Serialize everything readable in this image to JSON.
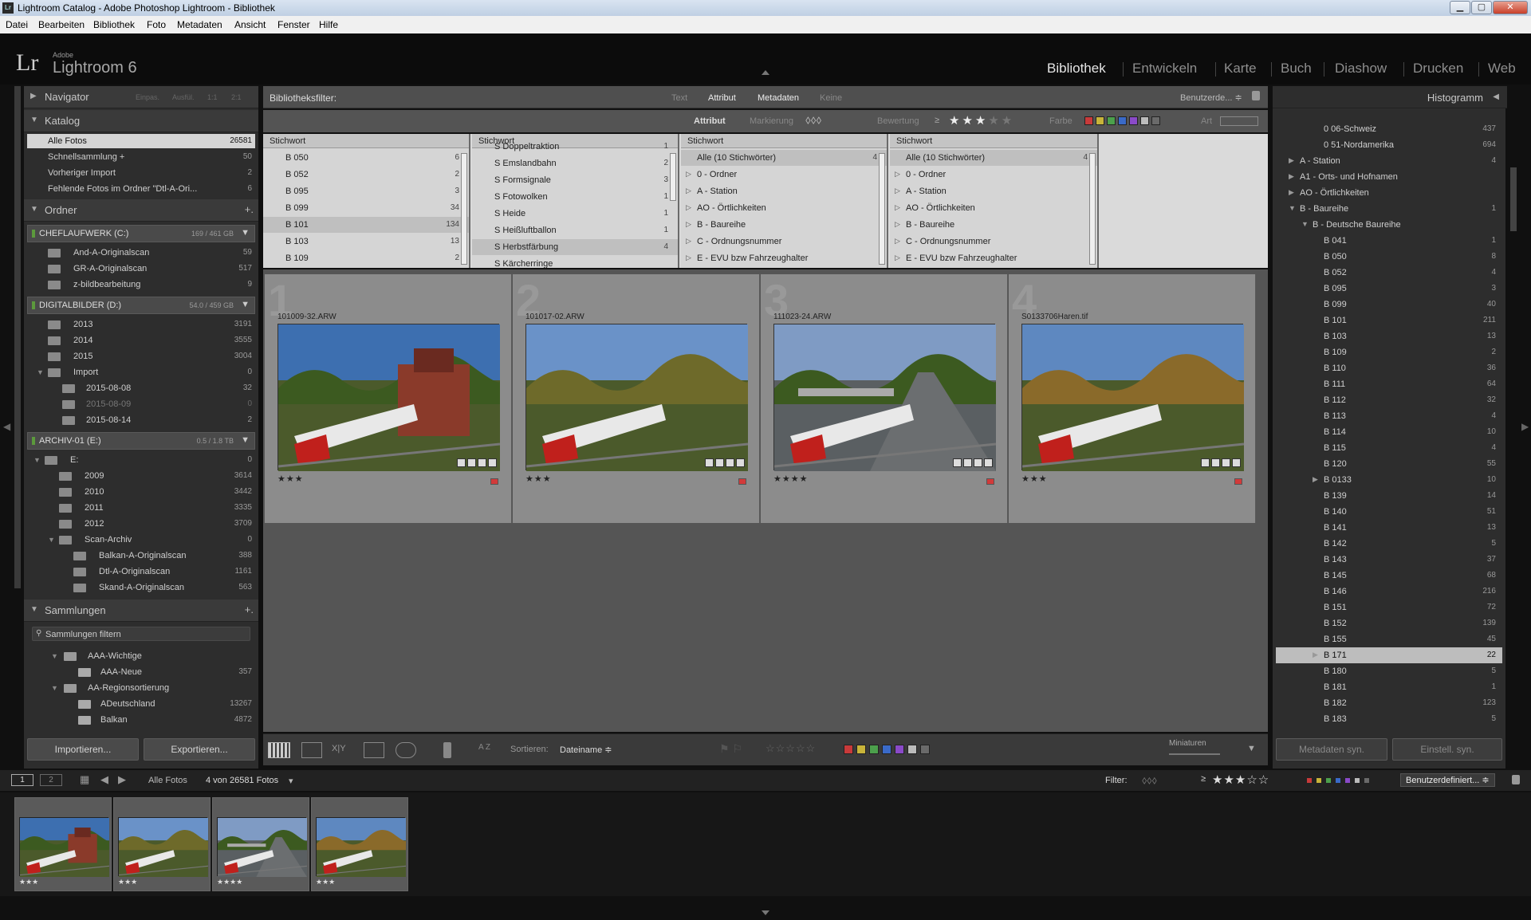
{
  "window": {
    "title": "Lightroom Catalog - Adobe Photoshop Lightroom - Bibliothek",
    "app_icon": "Lr"
  },
  "menu": [
    "Datei",
    "Bearbeiten",
    "Bibliothek",
    "Foto",
    "Metadaten",
    "Ansicht",
    "Fenster",
    "Hilfe"
  ],
  "logo": {
    "mark": "Lr",
    "adobe": "Adobe",
    "product": "Lightroom 6"
  },
  "modules": [
    "Bibliothek",
    "Entwickeln",
    "Karte",
    "Buch",
    "Diashow",
    "Drucken",
    "Web"
  ],
  "active_module": "Bibliothek",
  "left": {
    "navigator": {
      "label": "Navigator",
      "zoom": [
        "Einpas.",
        "Ausfül.",
        "1:1",
        "2:1"
      ]
    },
    "catalog": {
      "label": "Katalog",
      "items": [
        {
          "name": "Alle Fotos",
          "count": "26581"
        },
        {
          "name": "Schnellsammlung +",
          "count": "50"
        },
        {
          "name": "Vorheriger Import",
          "count": "2"
        },
        {
          "name": "Fehlende Fotos im Ordner \"Dtl-A-Ori...",
          "count": "6"
        }
      ]
    },
    "folders": {
      "label": "Ordner",
      "add": "+.",
      "vol1": {
        "name": "CHEFLAUFWERK (C:)",
        "size": "169 / 461 GB"
      },
      "vol1_items": [
        {
          "name": "And-A-Originalscan",
          "count": "59"
        },
        {
          "name": "GR-A-Originalscan",
          "count": "517"
        },
        {
          "name": "z-bildbearbeitung",
          "count": "9"
        }
      ],
      "vol2": {
        "name": "DIGITALBILDER (D:)",
        "size": "54.0 / 459 GB"
      },
      "vol2_items": [
        {
          "name": "2013",
          "count": "3191"
        },
        {
          "name": "2014",
          "count": "3555"
        },
        {
          "name": "2015",
          "count": "3004"
        },
        {
          "name": "Import",
          "count": "0"
        },
        {
          "name": "2015-08-08",
          "count": "32"
        },
        {
          "name": "2015-08-09",
          "count": "0"
        },
        {
          "name": "2015-08-14",
          "count": "2"
        }
      ],
      "vol3": {
        "name": "ARCHIV-01 (E:)",
        "size": "0.5 / 1.8 TB"
      },
      "vol3_items": [
        {
          "name": "E:",
          "count": "0"
        },
        {
          "name": "2009",
          "count": "3614"
        },
        {
          "name": "2010",
          "count": "3442"
        },
        {
          "name": "2011",
          "count": "3335"
        },
        {
          "name": "2012",
          "count": "3709"
        },
        {
          "name": "Scan-Archiv",
          "count": "0"
        },
        {
          "name": "Balkan-A-Originalscan",
          "count": "388"
        },
        {
          "name": "Dtl-A-Originalscan",
          "count": "1161"
        },
        {
          "name": "Skand-A-Originalscan",
          "count": "563"
        }
      ]
    },
    "collections": {
      "label": "Sammlungen",
      "add": "+.",
      "filter_placeholder": "Sammlungen filtern",
      "items": [
        {
          "name": "AAA-Wichtige",
          "count": ""
        },
        {
          "name": "AAA-Neue",
          "count": "357"
        },
        {
          "name": "AA-Regionsortierung",
          "count": ""
        },
        {
          "name": "ADeutschland",
          "count": "13267"
        },
        {
          "name": "Balkan",
          "count": "4872"
        }
      ]
    },
    "import_btn": "Importieren...",
    "export_btn": "Exportieren..."
  },
  "filterbar": {
    "label": "Bibliotheksfilter:",
    "tabs": [
      "Text",
      "Attribut",
      "Metadaten",
      "Keine"
    ],
    "preset": "Benutzerde... ≑",
    "attr_label": "Attribut",
    "flag_label": "Markierung",
    "rating_label": "Bewertung",
    "rating_op": "≥",
    "color_label": "Farbe",
    "kind_label": "Art",
    "label_colors": [
      "#c83a3a",
      "#c8b43a",
      "#4ca04c",
      "#3a6ac8",
      "#8a4ac8",
      "#bbbbbb",
      "#6a6a6a"
    ]
  },
  "columns": [
    {
      "header": "Stichwort",
      "items": [
        {
          "n": "B 050",
          "c": "6"
        },
        {
          "n": "B 052",
          "c": "2"
        },
        {
          "n": "B 095",
          "c": "3"
        },
        {
          "n": "B 099",
          "c": "34"
        },
        {
          "n": "B 101",
          "c": "134"
        },
        {
          "n": "B 103",
          "c": "13"
        },
        {
          "n": "B 109",
          "c": "2"
        }
      ],
      "selected": 4
    },
    {
      "header": "Stichwort",
      "items": [
        {
          "n": "S Doppeltraktion",
          "c": "1"
        },
        {
          "n": "S Emslandbahn",
          "c": "2"
        },
        {
          "n": "S Formsignale",
          "c": "3"
        },
        {
          "n": "S Fotowolken",
          "c": "1"
        },
        {
          "n": "S Heide",
          "c": "1"
        },
        {
          "n": "S Heißluftballon",
          "c": "1"
        },
        {
          "n": "S Herbstfärbung",
          "c": "4"
        },
        {
          "n": "S Kärcherringe",
          "c": ""
        }
      ],
      "selected": 6
    },
    {
      "header": "Stichwort",
      "items": [
        {
          "n": "Alle (10 Stichwörter)",
          "c": "4"
        },
        {
          "n": "0 - Ordner",
          "c": ""
        },
        {
          "n": "A - Station",
          "c": ""
        },
        {
          "n": "AO - Örtlichkeiten",
          "c": ""
        },
        {
          "n": "B - Baureihe",
          "c": ""
        },
        {
          "n": "C - Ordnungsnummer",
          "c": ""
        },
        {
          "n": "E - EVU bzw Fahrzeughalter",
          "c": ""
        }
      ],
      "selected": 0
    },
    {
      "header": "Stichwort",
      "items": [
        {
          "n": "Alle (10 Stichwörter)",
          "c": "4"
        },
        {
          "n": "0 - Ordner",
          "c": ""
        },
        {
          "n": "A - Station",
          "c": ""
        },
        {
          "n": "AO - Örtlichkeiten",
          "c": ""
        },
        {
          "n": "B - Baureihe",
          "c": ""
        },
        {
          "n": "C - Ordnungsnummer",
          "c": ""
        },
        {
          "n": "E - EVU bzw Fahrzeughalter",
          "c": ""
        }
      ],
      "selected": 0
    }
  ],
  "photos": [
    {
      "index": "1",
      "file": "101009-32.ARW",
      "stars": "★★★",
      "sky": "#3d6fb0"
    },
    {
      "index": "2",
      "file": "101017-02.ARW",
      "stars": "★★★",
      "sky": "#6a92c8"
    },
    {
      "index": "3",
      "file": "111023-24.ARW",
      "stars": "★★★★",
      "sky": "#7f9bc4"
    },
    {
      "index": "4",
      "file": "S0133706Haren.tif",
      "stars": "★★★",
      "sky": "#5e88c0"
    }
  ],
  "toolbar": {
    "sort_label": "Sortieren:",
    "sort_value": "Dateiname ≑",
    "thumb_label": "Miniaturen",
    "az": "A Z"
  },
  "right": {
    "histogram": "Histogramm",
    "keywords": [
      {
        "n": "0 06-Schweiz",
        "c": "437",
        "lvl": 2
      },
      {
        "n": "0 51-Nordamerika",
        "c": "694",
        "lvl": 2
      },
      {
        "n": "A - Station",
        "c": "4",
        "lvl": 0
      },
      {
        "n": "A1 - Orts- und Hofnamen",
        "c": "",
        "lvl": 0
      },
      {
        "n": "AO - Örtlichkeiten",
        "c": "",
        "lvl": 0
      },
      {
        "n": "B - Baureihe",
        "c": "1",
        "lvl": 0
      },
      {
        "n": "B - Deutsche Baureihe",
        "c": "",
        "lvl": 1
      },
      {
        "n": "B 041",
        "c": "1",
        "lvl": 2
      },
      {
        "n": "B 050",
        "c": "8",
        "lvl": 2
      },
      {
        "n": "B 052",
        "c": "4",
        "lvl": 2
      },
      {
        "n": "B 095",
        "c": "3",
        "lvl": 2
      },
      {
        "n": "B 099",
        "c": "40",
        "lvl": 2
      },
      {
        "n": "B 101",
        "c": "211",
        "lvl": 2
      },
      {
        "n": "B 103",
        "c": "13",
        "lvl": 2
      },
      {
        "n": "B 109",
        "c": "2",
        "lvl": 2
      },
      {
        "n": "B 110",
        "c": "36",
        "lvl": 2
      },
      {
        "n": "B 111",
        "c": "64",
        "lvl": 2
      },
      {
        "n": "B 112",
        "c": "32",
        "lvl": 2
      },
      {
        "n": "B 113",
        "c": "4",
        "lvl": 2
      },
      {
        "n": "B 114",
        "c": "10",
        "lvl": 2
      },
      {
        "n": "B 115",
        "c": "4",
        "lvl": 2
      },
      {
        "n": "B 120",
        "c": "55",
        "lvl": 2
      },
      {
        "n": "B 0133",
        "c": "10",
        "lvl": 2
      },
      {
        "n": "B 139",
        "c": "14",
        "lvl": 2
      },
      {
        "n": "B 140",
        "c": "51",
        "lvl": 2
      },
      {
        "n": "B 141",
        "c": "13",
        "lvl": 2
      },
      {
        "n": "B 142",
        "c": "5",
        "lvl": 2
      },
      {
        "n": "B 143",
        "c": "37",
        "lvl": 2
      },
      {
        "n": "B 145",
        "c": "68",
        "lvl": 2
      },
      {
        "n": "B 146",
        "c": "216",
        "lvl": 2
      },
      {
        "n": "B 151",
        "c": "72",
        "lvl": 2
      },
      {
        "n": "B 152",
        "c": "139",
        "lvl": 2
      },
      {
        "n": "B 155",
        "c": "45",
        "lvl": 2
      },
      {
        "n": "B 171",
        "c": "22",
        "lvl": 2
      },
      {
        "n": "B 180",
        "c": "5",
        "lvl": 2
      },
      {
        "n": "B 181",
        "c": "1",
        "lvl": 2
      },
      {
        "n": "B 182",
        "c": "123",
        "lvl": 2
      },
      {
        "n": "B 183",
        "c": "5",
        "lvl": 2
      }
    ],
    "selected": "B 171",
    "sync_meta": "Metadaten syn.",
    "sync_settings": "Einstell. syn."
  },
  "filmstrip": {
    "screen1": "1",
    "screen2": "2",
    "source": "Alle Fotos",
    "count": "4 von 26581 Fotos",
    "filter_label": "Filter:",
    "rating_op": "≥",
    "stars": "★★★☆☆",
    "preset": "Benutzerdefiniert... ≑"
  }
}
